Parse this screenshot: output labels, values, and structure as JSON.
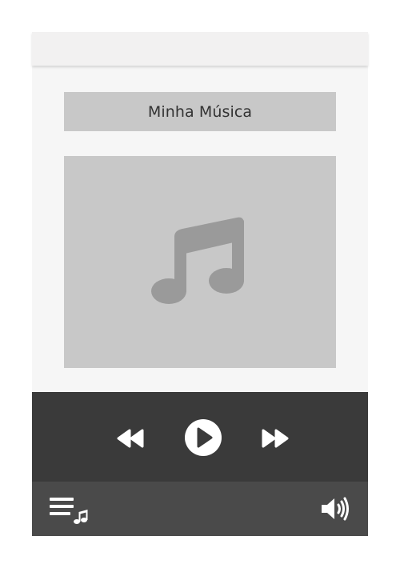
{
  "player": {
    "track_title": "Minha Música"
  },
  "icons": {
    "album_art": "music-note-icon",
    "previous": "rewind-icon",
    "play": "play-icon",
    "next": "fast-forward-icon",
    "playlist": "playlist-icon",
    "volume": "volume-icon"
  },
  "colors": {
    "background": "#f6f6f6",
    "controls_bar": "#3a3a3a",
    "bottom_bar": "#4a4a4a",
    "placeholder": "#c8c8c8",
    "icon": "#ffffff"
  }
}
